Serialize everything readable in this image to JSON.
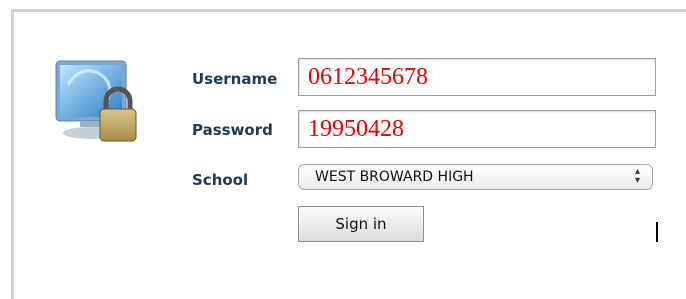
{
  "login": {
    "username_label": "Username",
    "username_value": "0612345678",
    "password_label": "Password",
    "password_value": "19950428",
    "school_label": "School",
    "school_selected": "WEST BROWARD HIGH",
    "signin_label": "Sign in"
  },
  "colors": {
    "label": "#1f3a55",
    "field_text": "#e60000",
    "panel_border": "#cdd6df"
  },
  "icons": {
    "logo": "computer-lock-icon",
    "select": "updown-arrows-icon"
  }
}
